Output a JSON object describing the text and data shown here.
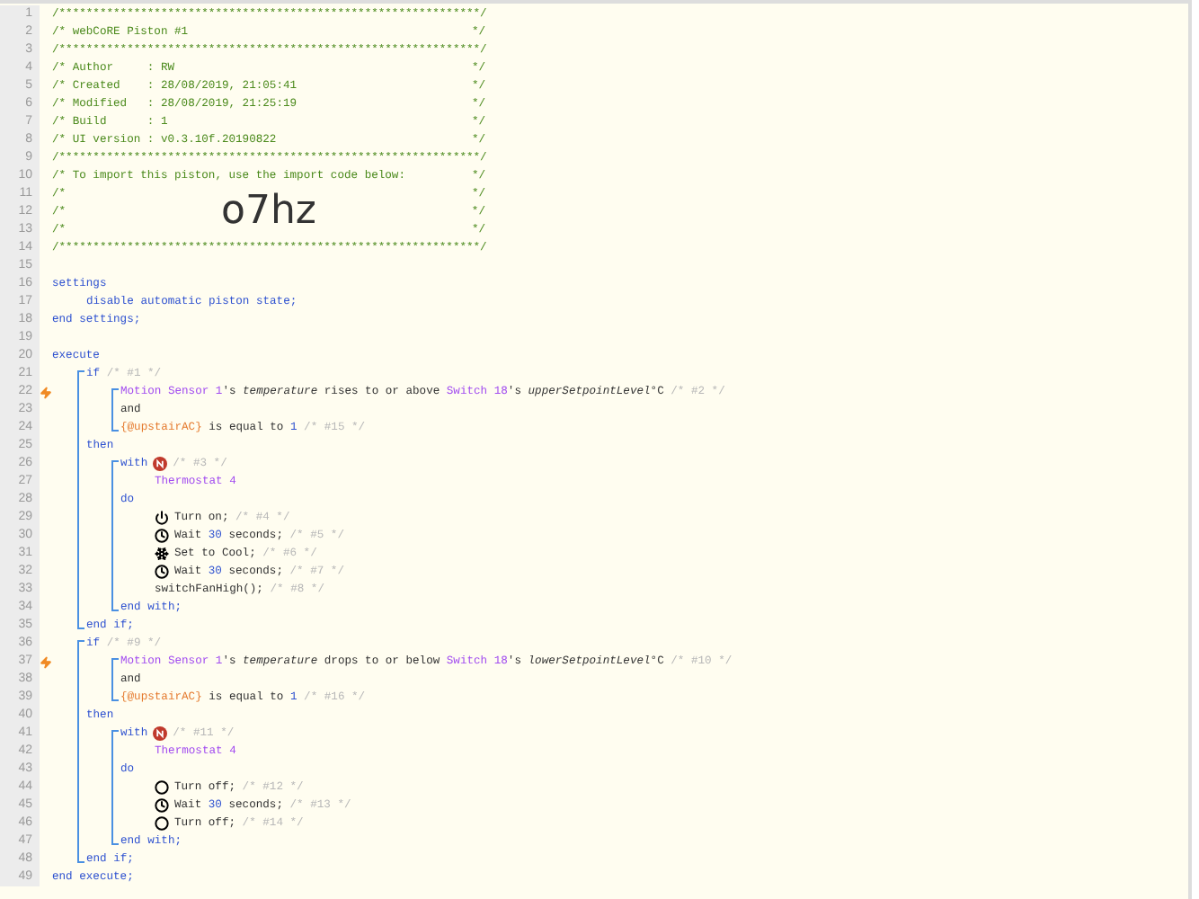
{
  "lines": [
    {
      "kind": "header",
      "number": "1",
      "segments": [
        {
          "kind": "comment",
          "text": "/**************************************************************/"
        }
      ]
    },
    {
      "kind": "header",
      "number": "2",
      "segments": [
        {
          "kind": "comment",
          "text": "/* webCoRE Piston #1"
        },
        {
          "kind": "comment",
          "text": "*/"
        }
      ]
    },
    {
      "kind": "header",
      "number": "3",
      "segments": [
        {
          "kind": "comment",
          "text": "/**************************************************************/"
        }
      ]
    },
    {
      "kind": "header",
      "number": "4",
      "segments": [
        {
          "kind": "comment",
          "text": "/* Author     : RW"
        },
        {
          "kind": "comment",
          "text": "*/"
        }
      ]
    },
    {
      "kind": "header",
      "number": "5",
      "segments": [
        {
          "kind": "comment",
          "text": "/* Created    : 28/08/2019, 21:05:41"
        },
        {
          "kind": "comment",
          "text": "*/"
        }
      ]
    },
    {
      "kind": "header",
      "number": "6",
      "segments": [
        {
          "kind": "comment",
          "text": "/* Modified   : 28/08/2019, 21:25:19"
        },
        {
          "kind": "comment",
          "text": "*/"
        }
      ]
    },
    {
      "kind": "header",
      "number": "7",
      "segments": [
        {
          "kind": "comment",
          "text": "/* Build      : 1"
        },
        {
          "kind": "comment",
          "text": "*/"
        }
      ]
    },
    {
      "kind": "header",
      "number": "8",
      "segments": [
        {
          "kind": "comment",
          "text": "/* UI version : v0.3.10f.20190822"
        },
        {
          "kind": "comment",
          "text": "*/"
        }
      ]
    },
    {
      "kind": "header",
      "number": "9",
      "segments": [
        {
          "kind": "comment",
          "text": "/**************************************************************/"
        }
      ]
    },
    {
      "kind": "header",
      "number": "10",
      "segments": [
        {
          "kind": "comment",
          "text": "/* To import this piston, use the import code below:"
        },
        {
          "kind": "comment",
          "text": "*/"
        }
      ]
    },
    {
      "kind": "header",
      "number": "11",
      "segments": [
        {
          "kind": "comment",
          "text": "/*"
        },
        {
          "kind": "comment",
          "text": "*/"
        }
      ]
    },
    {
      "kind": "header",
      "number": "12",
      "segments": [
        {
          "kind": "comment",
          "text": "/*"
        },
        {
          "kind": "code",
          "text": "o7hz"
        },
        {
          "kind": "comment",
          "text": "*/"
        }
      ]
    },
    {
      "kind": "header",
      "number": "13",
      "segments": [
        {
          "kind": "comment",
          "text": "/*"
        },
        {
          "kind": "comment",
          "text": "*/"
        }
      ]
    },
    {
      "kind": "header",
      "number": "14",
      "segments": [
        {
          "kind": "comment",
          "text": "/**************************************************************/"
        }
      ]
    },
    {
      "kind": "line",
      "number": "15"
    },
    {
      "kind": "line",
      "number": "16",
      "segments": [
        {
          "kind": "keyword",
          "text": "settings"
        }
      ],
      "children": [
        {
          "kind": "line",
          "number": "17",
          "segments": [
            {
              "kind": "keyword",
              "text": "disable automatic piston state;"
            }
          ]
        }
      ]
    },
    {
      "kind": "line",
      "number": "18",
      "segments": [
        {
          "kind": "keyword",
          "text": "end settings;"
        }
      ]
    },
    {
      "kind": "line",
      "number": "19"
    },
    {
      "kind": "line",
      "number": "20",
      "segments": [
        {
          "kind": "keyword",
          "text": "execute"
        }
      ],
      "children": [
        {
          "kind": "group",
          "children": [
            {
              "kind": "line",
              "number": "21",
              "segments": [
                {
                  "kind": "keyword",
                  "text": "if"
                },
                {
                  "kind": "note",
                  "text": " /* #1 */"
                }
              ],
              "children": [
                {
                  "kind": "group",
                  "children": [
                    {
                      "kind": "line",
                      "number": "22",
                      "bolt": true,
                      "segments": [
                        {
                          "kind": "device",
                          "text": "Motion Sensor 1"
                        },
                        {
                          "kind": "plain",
                          "text": "'s "
                        },
                        {
                          "kind": "italic",
                          "text": "temperature"
                        },
                        {
                          "kind": "plain",
                          "text": " rises to or above "
                        },
                        {
                          "kind": "device",
                          "text": "Switch 18"
                        },
                        {
                          "kind": "plain",
                          "text": "'s "
                        },
                        {
                          "kind": "italic",
                          "text": "upperSetpointLevel"
                        },
                        {
                          "kind": "plain",
                          "text": "°C"
                        },
                        {
                          "kind": "note",
                          "text": " /* #2 */"
                        }
                      ]
                    },
                    {
                      "kind": "line",
                      "number": "23",
                      "segments": [
                        {
                          "kind": "plain",
                          "text": "and"
                        }
                      ]
                    },
                    {
                      "kind": "line",
                      "number": "24",
                      "segments": [
                        {
                          "kind": "variable",
                          "text": "{@upstairAC}"
                        },
                        {
                          "kind": "plain",
                          "text": " is equal to "
                        },
                        {
                          "kind": "number",
                          "text": "1"
                        },
                        {
                          "kind": "note",
                          "text": " /* #15 */"
                        }
                      ]
                    }
                  ]
                }
              ]
            },
            {
              "kind": "line",
              "number": "25",
              "segments": [
                {
                  "kind": "keyword",
                  "text": "then"
                }
              ],
              "children": [
                {
                  "kind": "group",
                  "children": [
                    {
                      "kind": "line",
                      "number": "26",
                      "segments": [
                        {
                          "kind": "keyword",
                          "text": "with"
                        },
                        {
                          "kind": "status"
                        },
                        {
                          "kind": "note",
                          "text": "/* #3 */"
                        }
                      ],
                      "children": [
                        {
                          "kind": "line",
                          "number": "27",
                          "segments": [
                            {
                              "kind": "device",
                              "text": "Thermostat 4"
                            }
                          ]
                        }
                      ]
                    },
                    {
                      "kind": "line",
                      "number": "28",
                      "segments": [
                        {
                          "kind": "keyword",
                          "text": "do"
                        }
                      ],
                      "children": [
                        {
                          "kind": "line",
                          "number": "29",
                          "segments": [
                            {
                              "kind": "power"
                            },
                            {
                              "kind": "plain",
                              "text": "Turn on;"
                            },
                            {
                              "kind": "note",
                              "text": " /* #4 */"
                            }
                          ]
                        },
                        {
                          "kind": "line",
                          "number": "30",
                          "segments": [
                            {
                              "kind": "clock"
                            },
                            {
                              "kind": "plain",
                              "text": "Wait "
                            },
                            {
                              "kind": "number",
                              "text": "30"
                            },
                            {
                              "kind": "plain",
                              "text": " seconds;"
                            },
                            {
                              "kind": "note",
                              "text": " /* #5 */"
                            }
                          ]
                        },
                        {
                          "kind": "line",
                          "number": "31",
                          "segments": [
                            {
                              "kind": "snowflake"
                            },
                            {
                              "kind": "plain",
                              "text": "Set to Cool;"
                            },
                            {
                              "kind": "note",
                              "text": " /* #6 */"
                            }
                          ]
                        },
                        {
                          "kind": "line",
                          "number": "32",
                          "segments": [
                            {
                              "kind": "clock"
                            },
                            {
                              "kind": "plain",
                              "text": "Wait "
                            },
                            {
                              "kind": "number",
                              "text": "30"
                            },
                            {
                              "kind": "plain",
                              "text": " seconds;"
                            },
                            {
                              "kind": "note",
                              "text": " /* #7 */"
                            }
                          ]
                        },
                        {
                          "kind": "line",
                          "number": "33",
                          "segments": [
                            {
                              "kind": "plain",
                              "text": "switchFanHigh();"
                            },
                            {
                              "kind": "note",
                              "text": " /* #8 */"
                            }
                          ]
                        }
                      ]
                    },
                    {
                      "kind": "line",
                      "number": "34",
                      "segments": [
                        {
                          "kind": "keyword",
                          "text": "end with;"
                        }
                      ]
                    }
                  ]
                }
              ]
            },
            {
              "kind": "line",
              "number": "35",
              "segments": [
                {
                  "kind": "keyword",
                  "text": "end if;"
                }
              ]
            }
          ]
        },
        {
          "kind": "group",
          "children": [
            {
              "kind": "line",
              "number": "36",
              "segments": [
                {
                  "kind": "keyword",
                  "text": "if"
                },
                {
                  "kind": "note",
                  "text": " /* #9 */"
                }
              ],
              "children": [
                {
                  "kind": "group",
                  "children": [
                    {
                      "kind": "line",
                      "number": "37",
                      "bolt": true,
                      "segments": [
                        {
                          "kind": "device",
                          "text": "Motion Sensor 1"
                        },
                        {
                          "kind": "plain",
                          "text": "'s "
                        },
                        {
                          "kind": "italic",
                          "text": "temperature"
                        },
                        {
                          "kind": "plain",
                          "text": " drops to or below "
                        },
                        {
                          "kind": "device",
                          "text": "Switch 18"
                        },
                        {
                          "kind": "plain",
                          "text": "'s "
                        },
                        {
                          "kind": "italic",
                          "text": "lowerSetpointLevel"
                        },
                        {
                          "kind": "plain",
                          "text": "°C"
                        },
                        {
                          "kind": "note",
                          "text": " /* #10 */"
                        }
                      ]
                    },
                    {
                      "kind": "line",
                      "number": "38",
                      "segments": [
                        {
                          "kind": "plain",
                          "text": "and"
                        }
                      ]
                    },
                    {
                      "kind": "line",
                      "number": "39",
                      "segments": [
                        {
                          "kind": "variable",
                          "text": "{@upstairAC}"
                        },
                        {
                          "kind": "plain",
                          "text": " is equal to "
                        },
                        {
                          "kind": "number",
                          "text": "1"
                        },
                        {
                          "kind": "note",
                          "text": " /* #16 */"
                        }
                      ]
                    }
                  ]
                }
              ]
            },
            {
              "kind": "line",
              "number": "40",
              "segments": [
                {
                  "kind": "keyword",
                  "text": "then"
                }
              ],
              "children": [
                {
                  "kind": "group",
                  "children": [
                    {
                      "kind": "line",
                      "number": "41",
                      "segments": [
                        {
                          "kind": "keyword",
                          "text": "with"
                        },
                        {
                          "kind": "status"
                        },
                        {
                          "kind": "note",
                          "text": "/* #11 */"
                        }
                      ],
                      "children": [
                        {
                          "kind": "line",
                          "number": "42",
                          "segments": [
                            {
                              "kind": "device",
                              "text": "Thermostat 4"
                            }
                          ]
                        }
                      ]
                    },
                    {
                      "kind": "line",
                      "number": "43",
                      "segments": [
                        {
                          "kind": "keyword",
                          "text": "do"
                        }
                      ],
                      "children": [
                        {
                          "kind": "line",
                          "number": "44",
                          "segments": [
                            {
                              "kind": "off"
                            },
                            {
                              "kind": "plain",
                              "text": "Turn off;"
                            },
                            {
                              "kind": "note",
                              "text": " /* #12 */"
                            }
                          ]
                        },
                        {
                          "kind": "line",
                          "number": "45",
                          "segments": [
                            {
                              "kind": "clock"
                            },
                            {
                              "kind": "plain",
                              "text": "Wait "
                            },
                            {
                              "kind": "number",
                              "text": "30"
                            },
                            {
                              "kind": "plain",
                              "text": " seconds;"
                            },
                            {
                              "kind": "note",
                              "text": " /* #13 */"
                            }
                          ]
                        },
                        {
                          "kind": "line",
                          "number": "46",
                          "segments": [
                            {
                              "kind": "off"
                            },
                            {
                              "kind": "plain",
                              "text": "Turn off;"
                            },
                            {
                              "kind": "note",
                              "text": " /* #14 */"
                            }
                          ]
                        }
                      ]
                    },
                    {
                      "kind": "line",
                      "number": "47",
                      "segments": [
                        {
                          "kind": "keyword",
                          "text": "end with;"
                        }
                      ]
                    }
                  ]
                }
              ]
            },
            {
              "kind": "line",
              "number": "48",
              "segments": [
                {
                  "kind": "keyword",
                  "text": "end if;"
                }
              ]
            }
          ]
        }
      ]
    },
    {
      "kind": "line",
      "number": "49",
      "segments": [
        {
          "kind": "keyword",
          "text": "end execute;"
        }
      ]
    }
  ]
}
